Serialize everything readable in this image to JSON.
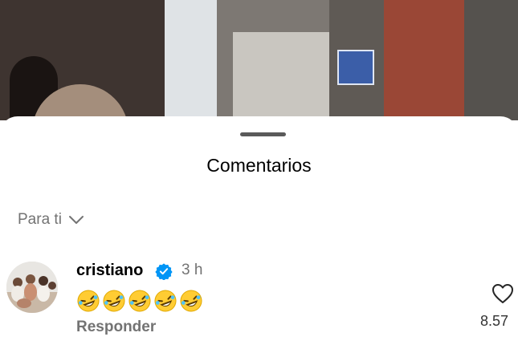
{
  "sheet": {
    "title": "Comentarios"
  },
  "filter": {
    "label": "Para ti"
  },
  "comment": {
    "username": "cristiano",
    "timestamp": "3 h",
    "text_emojis": [
      "🤣",
      "🤣",
      "🤣",
      "🤣",
      "🤣"
    ],
    "reply_label": "Responder",
    "likes": "8.57"
  },
  "icons": {
    "verified": "verified-badge-icon",
    "like": "heart-icon",
    "filter_chevron": "chevron-down-icon"
  },
  "colors": {
    "verified": "#0095f6",
    "secondary_text": "#737373"
  }
}
